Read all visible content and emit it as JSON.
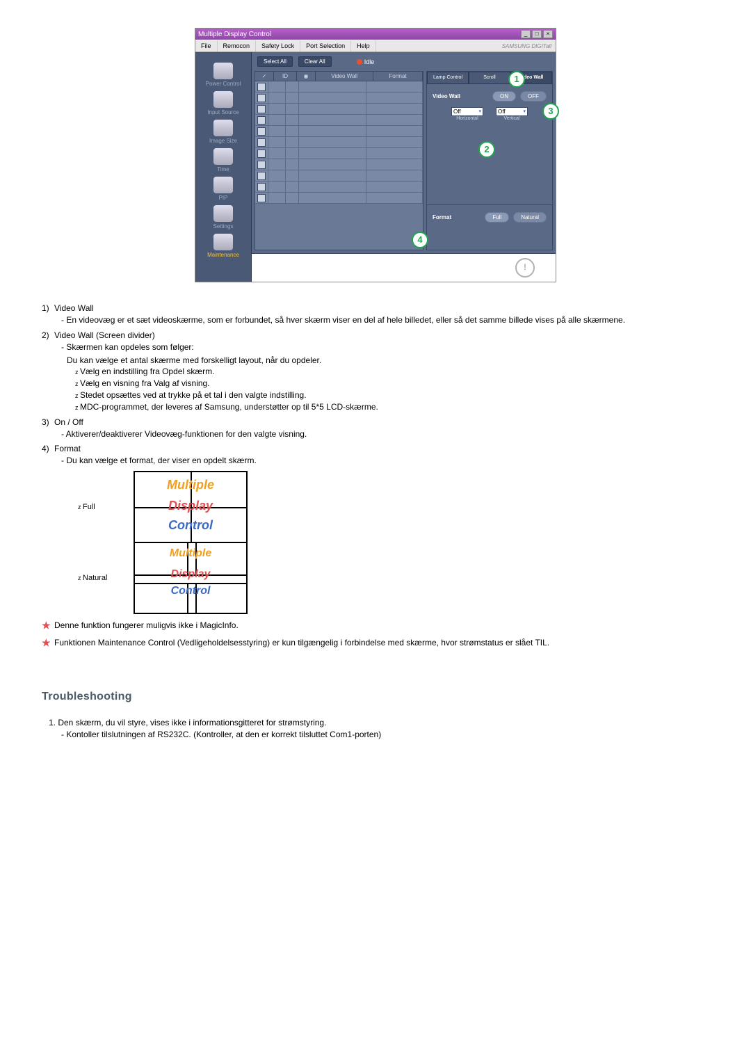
{
  "app": {
    "title": "Multiple Display Control",
    "menus": [
      "File",
      "Remocon",
      "Safety Lock",
      "Port Selection",
      "Help"
    ],
    "brand": "SAMSUNG DIGITall",
    "toolbar": {
      "select_all": "Select All",
      "clear_all": "Clear All",
      "idle": "Idle"
    },
    "grid_headers": {
      "chk": "✓",
      "id": "ID",
      "sig": "",
      "video_wall": "Video Wall",
      "format": "Format"
    },
    "sidebar": [
      {
        "label": "Power Control"
      },
      {
        "label": "Input Source"
      },
      {
        "label": "Image Size"
      },
      {
        "label": "Time"
      },
      {
        "label": "PIP"
      },
      {
        "label": "Settings"
      },
      {
        "label": "Maintenance"
      }
    ],
    "tabs": {
      "lamp": "Lamp Control",
      "scroll": "Scroll",
      "video_wall": "Video Wall"
    },
    "panel": {
      "video_wall_label": "Video Wall",
      "on": "ON",
      "off": "OFF",
      "h_value": "Off",
      "v_value": "Off",
      "h_label": "Horizontal",
      "v_label": "Vertical",
      "format_label": "Format",
      "full": "Full",
      "natural": "Natural"
    }
  },
  "markers": {
    "m1": "1",
    "m2": "2",
    "m3": "3",
    "m4": "4"
  },
  "doc": {
    "i1": {
      "n": "1)",
      "t": "Video Wall",
      "sub": "- En videovæg er et sæt videoskærme, som er forbundet, så hver skærm viser en del af hele billedet, eller så det samme billede vises på alle skærmene."
    },
    "i2": {
      "n": "2)",
      "t": "Video Wall (Screen divider)",
      "sub": "- Skærmen kan opdeles som følger:",
      "sub2": "Du kan vælge et antal skærme med forskelligt layout, når du opdeler.",
      "z1": "Vælg en indstilling fra Opdel skærm.",
      "z2": "Vælg en visning fra Valg af visning.",
      "z3": "Stedet opsættes ved at trykke på et tal i den valgte indstilling.",
      "z4": "MDC-programmet, der leveres af Samsung, understøtter op til 5*5 LCD-skærme."
    },
    "i3": {
      "n": "3)",
      "t": "On / Off",
      "sub": "- Aktiverer/deaktiverer Videovæg-funktionen for den valgte visning."
    },
    "i4": {
      "n": "4)",
      "t": "Format",
      "sub": "- Du kan vælge et format, der viser en opdelt skærm."
    },
    "fmt_full": "Full",
    "fmt_natural": "Natural",
    "mdc": {
      "l1": "Multiple",
      "l2": "Display",
      "l3": "Control"
    },
    "star1": "Denne funktion fungerer muligvis ikke i MagicInfo.",
    "star2": "Funktionen Maintenance Control (Vedligeholdelsesstyring) er kun tilgængelig i forbindelse med skærme, hvor strømstatus er slået TIL."
  },
  "ts": {
    "heading": "Troubleshooting",
    "i1": "1. Den skærm, du vil styre, vises ikke i informationsgitteret for strømstyring.",
    "i1s": "- Kontoller tilslutningen af RS232C. (Kontroller, at den er korrekt tilsluttet Com1-porten)"
  }
}
